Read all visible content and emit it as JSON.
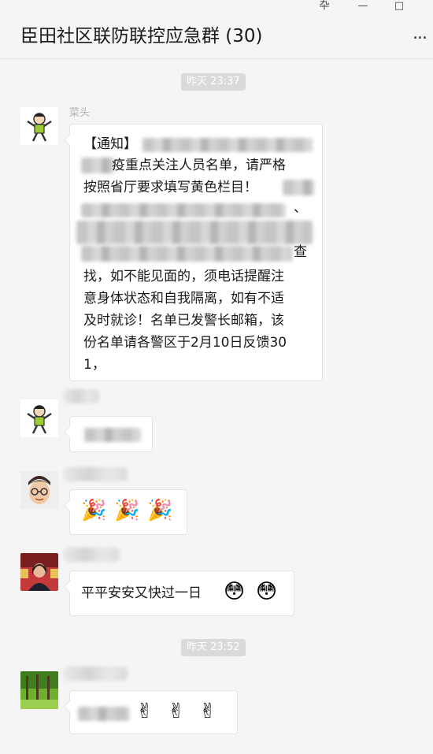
{
  "window": {
    "title": "臣田社区联防联控应急群 (30)",
    "pin_glyph": "卆",
    "minimize_glyph": "—",
    "maximize_glyph": "□",
    "more_glyph": "..."
  },
  "timestamps": [
    "昨天 23:37",
    "昨天 23:52"
  ],
  "messages": [
    {
      "sender": "菜头",
      "avatar_icon": "cartoon-avatar-icon",
      "lines": [
        "【通知】",
        "疫重点关注人员名单，请严格",
        "按照省厅要求填写黄色栏目！",
        "、",
        "查",
        "找，如不能见面的，须电话提醒注",
        "意身体状态和自我隔离，如有不适",
        "及时就诊！名单已发警长邮箱，该",
        "份名单请各警区于2月10日反馈30",
        "1，"
      ]
    },
    {
      "avatar_icon": "cartoon-avatar-icon"
    },
    {
      "avatar_icon": "memoji-avatar-icon",
      "emojis": [
        "🎉",
        "🎉",
        "🎉"
      ]
    },
    {
      "avatar_icon": "photo-avatar-icon",
      "text": "平平安安又快过一日",
      "emojis": [
        "😳",
        "😳"
      ]
    },
    {
      "avatar_icon": "forest-avatar-icon",
      "emojis": [
        "✌",
        "✌",
        "✌"
      ]
    }
  ]
}
